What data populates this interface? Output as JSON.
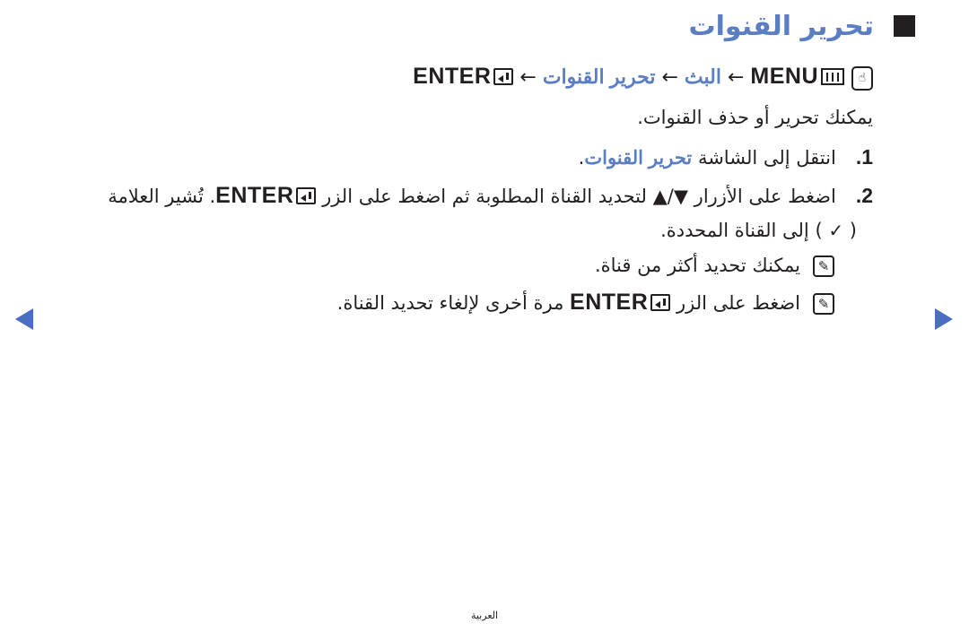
{
  "title": "تحرير القنوات",
  "path": {
    "menu_label": "MENU",
    "step1": "البث",
    "step2": "تحرير القنوات",
    "enter_label": "ENTER",
    "separator": "←"
  },
  "intro": "يمكنك تحرير أو حذف القنوات.",
  "steps": [
    {
      "number": "1.",
      "text_before": "انتقل إلى الشاشة",
      "link": "تحرير القنوات",
      "text_after": "."
    },
    {
      "number": "2.",
      "text_a": "اضغط على الأزرار",
      "arrows": "▲/▼",
      "text_b": "لتحديد القناة المطلوبة ثم اضغط على الزر",
      "enter_label": "ENTER",
      "text_c": ". تُشير العلامة",
      "line2_open": "(",
      "check": "✓",
      "line2_close": ")",
      "line2_text": "إلى القناة المحددة."
    }
  ],
  "notes": [
    {
      "text": "يمكنك تحديد أكثر من قناة."
    },
    {
      "text_a": "اضغط على الزر",
      "enter_label": "ENTER",
      "text_b": "مرة أخرى لإلغاء تحديد القناة."
    }
  ],
  "nav": {
    "prev": "previous-page",
    "next": "next-page"
  },
  "footer": "العربية",
  "colors": {
    "accent": "#5b7ec2",
    "arrow": "#4a6fc2",
    "text": "#231f20"
  }
}
